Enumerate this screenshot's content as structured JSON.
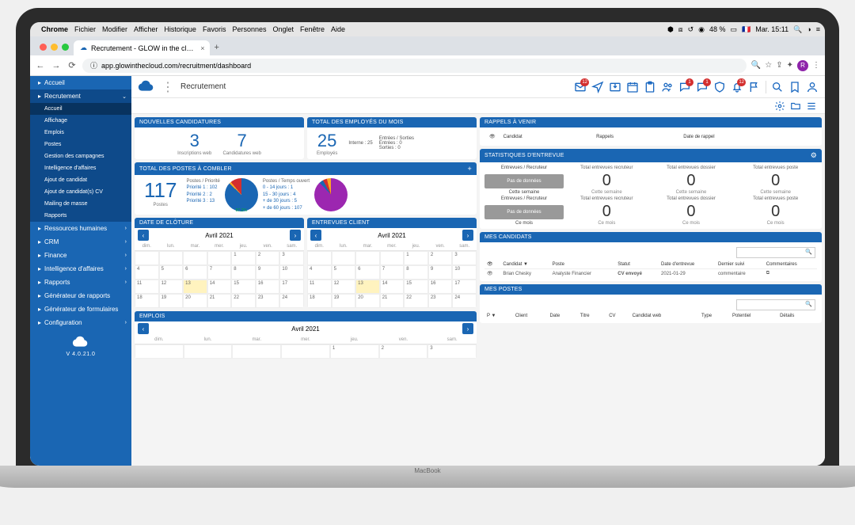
{
  "mac_menu": {
    "app": "Chrome",
    "items": [
      "Fichier",
      "Modifier",
      "Afficher",
      "Historique",
      "Favoris",
      "Personnes",
      "Onglet",
      "Fenêtre",
      "Aide"
    ],
    "battery": "48 %",
    "flag": "🇫🇷",
    "clock": "Mar. 15:11"
  },
  "browser": {
    "tab_title": "Recrutement - GLOW in the cl…",
    "url": "app.glowinthecloud.com/recruitment/dashboard",
    "profile_initial": "R"
  },
  "app_header": {
    "title": "Recrutement",
    "icon_badges": {
      "mail": "12",
      "msg1": "1",
      "msg2": "1",
      "bell": "12"
    }
  },
  "sidebar": {
    "items": [
      {
        "label": "Accueil",
        "icon": "home"
      },
      {
        "label": "Recrutement",
        "icon": "briefcase",
        "expanded": true,
        "children": [
          {
            "label": "Accueil",
            "active": true
          },
          {
            "label": "Affichage"
          },
          {
            "label": "Emplois"
          },
          {
            "label": "Postes"
          },
          {
            "label": "Gestion des campagnes"
          },
          {
            "label": "Intelligence d'affaires"
          },
          {
            "label": "Ajout de candidat"
          },
          {
            "label": "Ajout de candidat(s) CV"
          },
          {
            "label": "Mailing de masse"
          },
          {
            "label": "Rapports"
          }
        ]
      },
      {
        "label": "Ressources humaines",
        "icon": "people"
      },
      {
        "label": "CRM",
        "icon": "crm"
      },
      {
        "label": "Finance",
        "icon": "finance"
      },
      {
        "label": "Intelligence d'affaires",
        "icon": "bi"
      },
      {
        "label": "Rapports",
        "icon": "report"
      },
      {
        "label": "Générateur de rapports",
        "icon": "gen"
      },
      {
        "label": "Générateur de formulaires",
        "icon": "form"
      },
      {
        "label": "Configuration",
        "icon": "gear"
      }
    ],
    "version": "V 4.0.21.0"
  },
  "widgets": {
    "nouvelles_candidatures": {
      "title": "NOUVELLES CANDIDATURES",
      "cols": [
        {
          "value": "3",
          "label": "Inscriptions web"
        },
        {
          "value": "7",
          "label": "Candidatures web"
        }
      ]
    },
    "total_employes": {
      "title": "TOTAL DES EMPLOYÉS DU MOIS",
      "value": "25",
      "label": "Employés",
      "interne": "Interne : 25",
      "entrees_sorties_hdr": "Entrées / Sorties",
      "entrees": "Entrées : 0",
      "sorties": "Sorties : 0"
    },
    "rappels": {
      "title": "RAPPELS À VENIR",
      "cols": [
        "Candidat",
        "Rappels",
        "Date de rappel"
      ]
    },
    "postes_combler": {
      "title": "TOTAL DES POSTES À COMBLER",
      "value": "117",
      "label": "Postes",
      "prio_hdr": "Postes / Priorité",
      "priorities": [
        "Priorité 1 : 102",
        "Priorité 2 : 2",
        "Priorité 3 : 13"
      ],
      "temps_hdr": "Postes / Temps ouvert",
      "temps": [
        "0 - 14 jours : 1",
        "15 - 30 jours : 4",
        "+ de 30 jours : 5",
        "+ de 60 jours : 107"
      ]
    },
    "stats_entrevue": {
      "title": "STATISTIQUES D'ENTREVUE",
      "row1_side": "Entrevues / Recruteur",
      "row2_side": "Entrevues / Recruteur",
      "nodata": "Pas de données",
      "period1": "Cette semaine",
      "period2": "Ce mois",
      "headers": [
        "Total entrevues recruteur",
        "Total entrevues dossier",
        "Total entrevues poste"
      ],
      "values": [
        [
          "0",
          "0",
          "0"
        ],
        [
          "0",
          "0",
          "0"
        ]
      ],
      "subs": [
        [
          "Cette semaine",
          "Cette semaine",
          "Cette semaine"
        ],
        [
          "Ce mois",
          "Ce mois",
          "Ce mois"
        ]
      ]
    },
    "date_cloture": {
      "title": "DATE DE CLÔTURE",
      "month": "Avril 2021"
    },
    "entrevues_client": {
      "title": "ENTREVUES CLIENT",
      "month": "Avril 2021"
    },
    "emplois": {
      "title": "EMPLOIS",
      "month": "Avril 2021"
    },
    "mes_candidats": {
      "title": "MES CANDIDATS",
      "cols": [
        "#",
        "Candidat ▼",
        "Poste",
        "Statut",
        "Date d'entrevue",
        "Dernier suivi",
        "Commentaires"
      ],
      "rows": [
        {
          "candidat": "Brian Chesky",
          "poste": "Analyste Financier",
          "statut": "CV envoyé",
          "date": "2021-01-29",
          "suivi": "commentaire"
        }
      ]
    },
    "mes_postes": {
      "title": "MES POSTES",
      "cols": [
        "P ▼",
        "Client",
        "Date",
        "Titre",
        "CV",
        "Candidat web",
        "Type",
        "Potentiel",
        "Détails"
      ]
    }
  },
  "calendar": {
    "day_headers": [
      "dim.",
      "lun.",
      "mar.",
      "mer.",
      "jeu.",
      "ven.",
      "sam."
    ],
    "days": [
      [
        "",
        "",
        "",
        "",
        "1",
        "2",
        "3"
      ],
      [
        "4",
        "5",
        "6",
        "7",
        "8",
        "9",
        "10"
      ],
      [
        "11",
        "12",
        "13",
        "14",
        "15",
        "16",
        "17"
      ],
      [
        "18",
        "19",
        "20",
        "21",
        "22",
        "23",
        "24"
      ]
    ],
    "today": "13"
  },
  "chart_data": [
    {
      "type": "pie",
      "title": "Postes / Priorité",
      "series": [
        {
          "name": "Priorité 1",
          "value": 102,
          "color": "#1a66b3"
        },
        {
          "name": "Priorité 2",
          "value": 2,
          "color": "#f9a825"
        },
        {
          "name": "Priorité 3",
          "value": 13,
          "color": "#d32f2f"
        }
      ]
    },
    {
      "type": "pie",
      "title": "Postes / Temps ouvert",
      "series": [
        {
          "name": "0 - 14 jours",
          "value": 1
        },
        {
          "name": "15 - 30 jours",
          "value": 4
        },
        {
          "name": "+ de 30 jours",
          "value": 5
        },
        {
          "name": "+ de 60 jours",
          "value": 107
        }
      ]
    }
  ]
}
